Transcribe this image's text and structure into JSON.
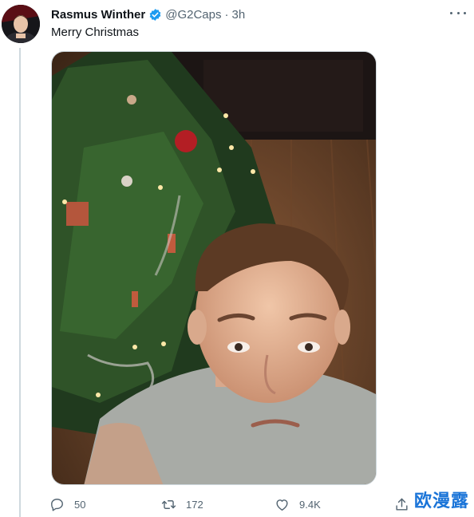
{
  "tweet": {
    "display_name": "Rasmus Winther",
    "handle": "@G2Caps",
    "separator": "·",
    "time": "3h",
    "text": "Merry Christmas",
    "verified": true
  },
  "media": {
    "alt_subject": "selfie-in-front-of-christmas-tree"
  },
  "actions": {
    "reply_count": "50",
    "retweet_count": "172",
    "like_count": "9.4K"
  },
  "icons": [
    "verified-badge-icon",
    "more-icon",
    "reply-icon",
    "retweet-icon",
    "like-icon",
    "share-icon"
  ],
  "colors": {
    "verified": "#1d9bf0",
    "secondary_text": "#536471",
    "watermark": "#1a74d8"
  },
  "watermark": "欧漫露"
}
